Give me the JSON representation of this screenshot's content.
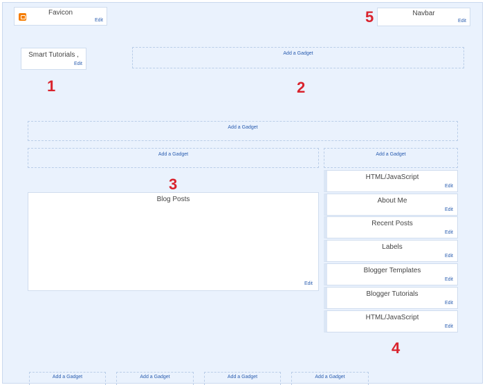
{
  "favicon": {
    "title": "Favicon",
    "edit": "Edit",
    "icon": "blogger-icon"
  },
  "navbar": {
    "title": "Navbar",
    "edit": "Edit"
  },
  "header": {
    "title": "Smart Tutorials ,",
    "edit": "Edit"
  },
  "add_gadget": "Add a Gadget",
  "blog_posts": {
    "title": "Blog Posts",
    "edit": "Edit"
  },
  "sidebar": {
    "items": [
      {
        "label": "HTML/JavaScript",
        "edit": "Edit"
      },
      {
        "label": "About Me",
        "edit": "Edit"
      },
      {
        "label": "Recent Posts",
        "edit": "Edit"
      },
      {
        "label": "Labels",
        "edit": "Edit"
      },
      {
        "label": "Blogger Templates",
        "edit": "Edit"
      },
      {
        "label": "Blogger Tutorials",
        "edit": "Edit"
      },
      {
        "label": "HTML/JavaScript",
        "edit": "Edit"
      }
    ]
  },
  "markers": [
    "1",
    "2",
    "3",
    "4",
    "5"
  ],
  "colors": {
    "marker": "#d9232d",
    "link": "#2a5db0",
    "canvas": "#eaf2fd",
    "blogger_orange": "#f57d00"
  }
}
